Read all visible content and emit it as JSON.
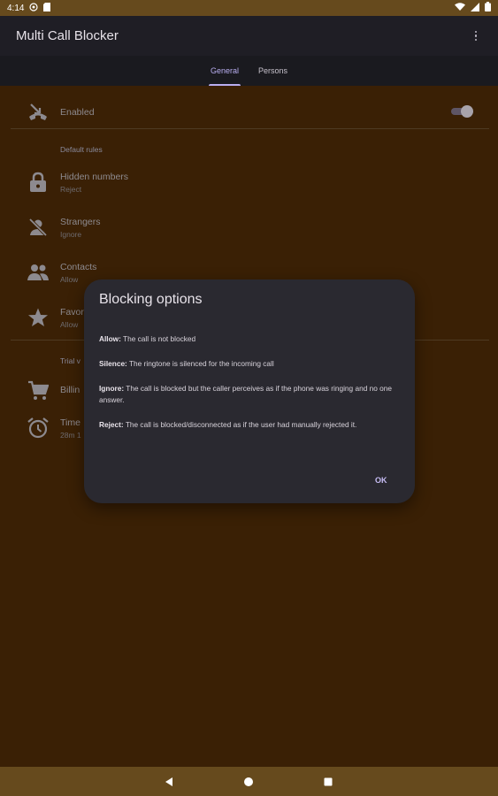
{
  "status_bar": {
    "time": "4:14",
    "colors": {
      "background": "#664a1d"
    }
  },
  "app_bar": {
    "title": "Multi Call Blocker",
    "overflow_icon": "more-vert-icon"
  },
  "tabs": [
    {
      "label": "General",
      "active": true
    },
    {
      "label": "Persons",
      "active": false
    }
  ],
  "settings": {
    "enabled": {
      "title": "Enabled",
      "icon": "call-end-icon",
      "toggle_on": true
    },
    "default_rules_label": "Default rules",
    "rules": [
      {
        "title": "Hidden numbers",
        "subtitle": "Reject",
        "icon": "lock-icon"
      },
      {
        "title": "Strangers",
        "subtitle": "Ignore",
        "icon": "person-off-icon"
      },
      {
        "title": "Contacts",
        "subtitle": "Allow",
        "icon": "contacts-icon"
      },
      {
        "title": "Favor",
        "subtitle": "Allow",
        "icon": "star-icon"
      }
    ],
    "trial_label": "Trial v",
    "billing": {
      "title": "Billin",
      "icon": "cart-icon"
    },
    "time": {
      "title": "Time",
      "subtitle": "28m 1",
      "icon": "alarm-icon"
    }
  },
  "dialog": {
    "title": "Blocking options",
    "items": [
      {
        "term": "Allow:",
        "text": " The call is not blocked"
      },
      {
        "term": "Silence:",
        "text": " The ringtone is silenced for the incoming call"
      },
      {
        "term": "Ignore:",
        "text": " The call is blocked but the caller perceives as if the phone was ringing and no one answer."
      },
      {
        "term": "Reject:",
        "text": " The call is blocked/disconnected as if the user had manually rejected it."
      }
    ],
    "ok_label": "OK"
  },
  "nav_bar": {
    "items": [
      "back-icon",
      "home-icon",
      "recents-icon"
    ]
  },
  "colors": {
    "background": "#3a2005",
    "app_bar": "#1f1e25",
    "dialog": "#2a2930",
    "accent": "#b9aef0"
  }
}
